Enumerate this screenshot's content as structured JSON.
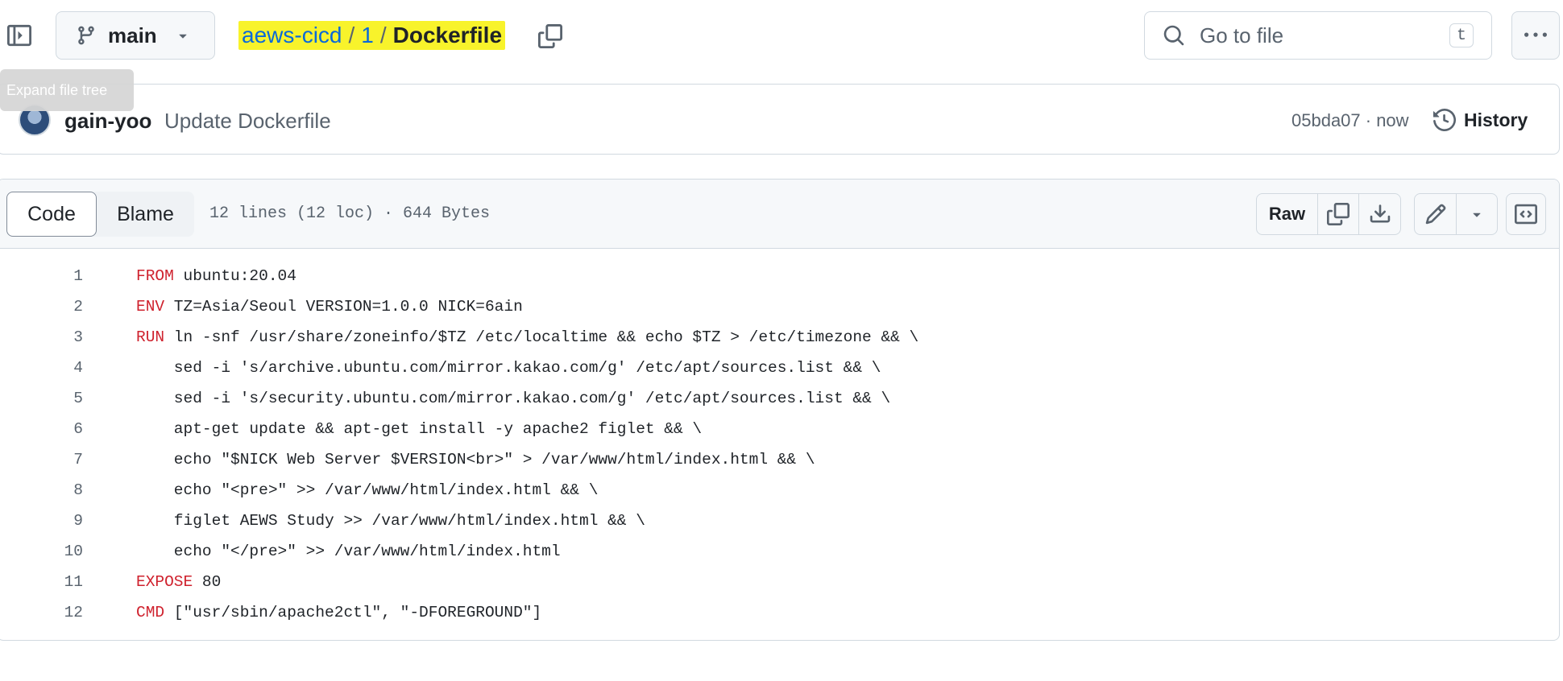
{
  "topbar": {
    "branch": "main",
    "breadcrumb": {
      "repo": "aews-cicd",
      "sep1": "/",
      "dir": "1",
      "sep2": "/",
      "file": "Dockerfile"
    },
    "goto_placeholder": "Go to file",
    "goto_shortcut": "t"
  },
  "tooltip": "Expand file tree",
  "commit": {
    "author": "gain-yoo",
    "message": "Update Dockerfile",
    "meta": "05bda07 · now",
    "history_label": "History"
  },
  "file": {
    "tabs": [
      "Code",
      "Blame"
    ],
    "info": "12 lines (12 loc) · 644 Bytes",
    "raw_label": "Raw"
  },
  "code_lines": [
    {
      "n": "1",
      "kw": "FROM",
      "rest": " ubuntu:20.04"
    },
    {
      "n": "2",
      "kw": "ENV",
      "rest": " TZ=Asia/Seoul VERSION=1.0.0 NICK=6ain"
    },
    {
      "n": "3",
      "kw": "RUN",
      "rest": " ln -snf /usr/share/zoneinfo/$TZ /etc/localtime && echo $TZ > /etc/timezone && \\"
    },
    {
      "n": "4",
      "kw": "",
      "rest": "    sed -i 's/archive.ubuntu.com/mirror.kakao.com/g' /etc/apt/sources.list && \\"
    },
    {
      "n": "5",
      "kw": "",
      "rest": "    sed -i 's/security.ubuntu.com/mirror.kakao.com/g' /etc/apt/sources.list && \\"
    },
    {
      "n": "6",
      "kw": "",
      "rest": "    apt-get update && apt-get install -y apache2 figlet && \\"
    },
    {
      "n": "7",
      "kw": "",
      "rest": "    echo \"$NICK Web Server $VERSION<br>\" > /var/www/html/index.html && \\"
    },
    {
      "n": "8",
      "kw": "",
      "rest": "    echo \"<pre>\" >> /var/www/html/index.html && \\"
    },
    {
      "n": "9",
      "kw": "",
      "rest": "    figlet AEWS Study >> /var/www/html/index.html && \\"
    },
    {
      "n": "10",
      "kw": "",
      "rest": "    echo \"</pre>\" >> /var/www/html/index.html"
    },
    {
      "n": "11",
      "kw": "EXPOSE",
      "rest": " 80"
    },
    {
      "n": "12",
      "kw": "CMD",
      "rest": " [\"usr/sbin/apache2ctl\", \"-DFOREGROUND\"]"
    }
  ],
  "colors": {
    "keyword": "#cf222e",
    "link": "#0969da",
    "highlight": "#f8f32b",
    "muted": "#59636e",
    "border": "#d1d9e0"
  },
  "icons": [
    "sidebar-expand-icon",
    "git-branch-icon",
    "chevron-down-icon",
    "copy-icon",
    "search-icon",
    "kebab-horizontal-icon",
    "history-icon",
    "download-icon",
    "pencil-icon",
    "symbols-icon"
  ]
}
